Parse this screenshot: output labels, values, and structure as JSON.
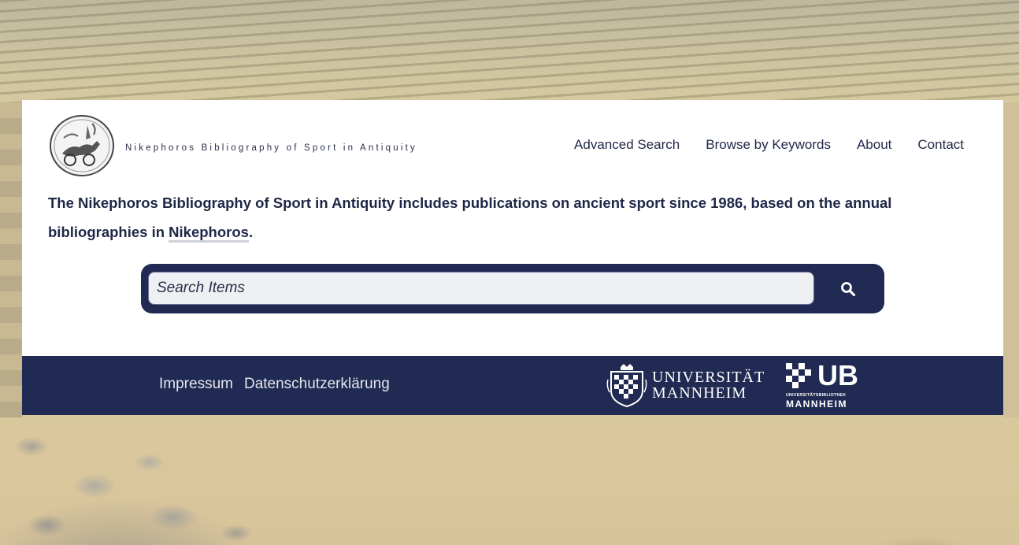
{
  "header": {
    "site_title": "Nikephoros Bibliography of Sport in Antiquity",
    "logo_icon": "coin-chariot-logo-icon"
  },
  "nav": {
    "items": [
      {
        "label": "Advanced Search"
      },
      {
        "label": "Browse by Keywords"
      },
      {
        "label": "About"
      },
      {
        "label": "Contact"
      }
    ]
  },
  "intro": {
    "text_before": "The Nikephoros Bibliography of Sport in Antiquity includes publications on ancient sport since 1986, based on the annual bibliographies in ",
    "link": "Nikephoros",
    "text_after": "."
  },
  "search": {
    "placeholder": "Search Items",
    "button_icon": "search-icon"
  },
  "footer": {
    "links": [
      {
        "label": "Impressum"
      },
      {
        "label": "Datenschutzerklärung"
      }
    ],
    "university": {
      "line1": "UNIVERSITÄT",
      "line2": "MANNHEIM"
    },
    "library": {
      "abbr": "UB",
      "subtitle": "UNIVERSITÄTSBIBLIOTHEK",
      "city": "MANNHEIM"
    }
  },
  "colors": {
    "navy": "#202a52",
    "text": "#1f2747",
    "white": "#ffffff"
  }
}
